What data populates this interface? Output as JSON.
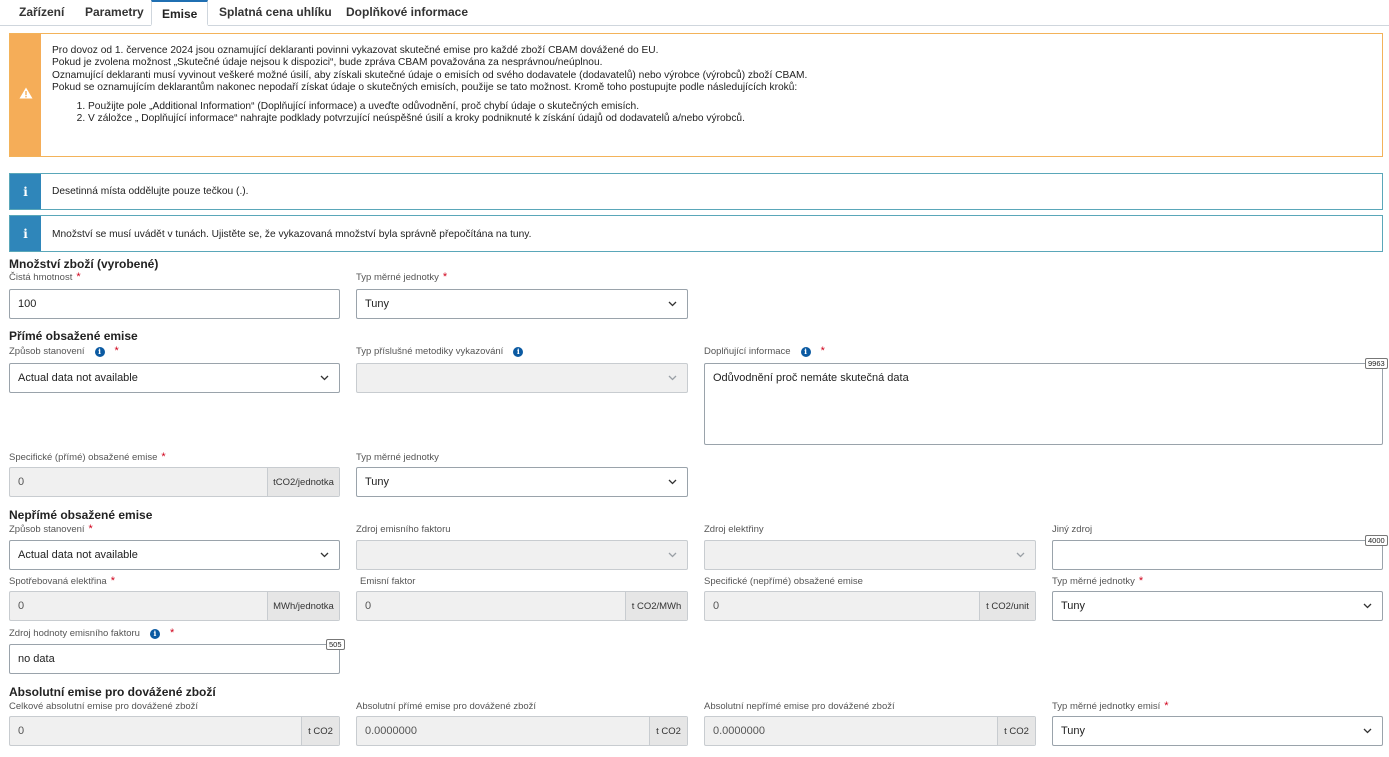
{
  "tabs": [
    {
      "label": "Zařízení"
    },
    {
      "label": "Parametry"
    },
    {
      "label": "Emise"
    },
    {
      "label": "Splatná cena uhlíku"
    },
    {
      "label": "Doplňkové informace"
    }
  ],
  "colors": {
    "warning": "#f5ad58",
    "info": "#2f86ba",
    "required": "#d0021b",
    "active_tab": "#1f6fb2"
  },
  "alerts": {
    "warning": {
      "icon": "warning-triangle-icon",
      "lines": [
        "Pro dovoz od 1. července 2024 jsou oznamující deklaranti povinni vykazovat skutečné emise pro každé zboží CBAM dovážené do EU.",
        "Pokud je zvolena možnost „Skutečné údaje nejsou k dispozici“, bude zpráva CBAM považována za nesprávnou/neúplnou.",
        "Oznamující deklaranti musí vyvinout veškeré možné úsilí, aby získali skutečné údaje o emisích od svého dodavatele (dodavatelů) nebo výrobce (výrobců) zboží CBAM.",
        "Pokud se oznamujícím deklarantům nakonec nepodaří získat údaje o skutečných emisích, použije se tato možnost. Kromě toho postupujte podle následujících kroků:"
      ],
      "steps": [
        "Použijte pole „Additional Information“ (Doplňující informace) a uveďte odůvodnění, proč chybí údaje o skutečných emisích.",
        "V záložce „ Doplňující informace“ nahrajte podklady potvrzující neúspěšné úsilí a kroky podniknuté k získání údajů od dodavatelů a/nebo výrobců."
      ]
    },
    "info1": {
      "icon": "info-icon",
      "text": "Desetinná místa oddělujte pouze tečkou (.)."
    },
    "info2": {
      "icon": "info-icon",
      "text": "Množství se musí uvádět v tunách. Ujistěte se, že vykazovaná množství byla správně přepočítána na tuny."
    }
  },
  "quantity": {
    "title": "Množství zboží (vyrobené)",
    "net_mass": {
      "label": "Čistá hmotnost",
      "value": "100"
    },
    "unit_type": {
      "label": "Typ měrné jednotky",
      "value": "Tuny"
    }
  },
  "direct": {
    "title": "Přímé obsažené emise",
    "method": {
      "label": "Způsob stanovení",
      "value": "Actual data not available"
    },
    "reporting_method": {
      "label": "Typ příslušné metodiky vykazování",
      "value": ""
    },
    "additional_info": {
      "label": "Doplňující informace",
      "value": "Odůvodnění proč nemáte skutečná data",
      "counter": "9963"
    },
    "specific": {
      "label": "Specifické (přímé) obsažené emise",
      "value": "0",
      "unit": "tCO2/jednotka"
    },
    "unit_type": {
      "label": "Typ měrné jednotky",
      "value": "Tuny"
    }
  },
  "indirect": {
    "title": "Nepřímé obsažené emise",
    "method": {
      "label": "Způsob stanovení",
      "value": "Actual data not available"
    },
    "factor_source": {
      "label": "Zdroj emisního faktoru",
      "value": ""
    },
    "electricity_source": {
      "label": "Zdroj elektřiny",
      "value": ""
    },
    "other_source": {
      "label": "Jiný zdroj",
      "value": "",
      "counter": "4000"
    },
    "consumed": {
      "label": "Spotřebovaná elektřina",
      "value": "0",
      "unit": "MWh/jednotka"
    },
    "factor": {
      "label": "Emisní faktor",
      "value": "0",
      "unit": "t CO2/MWh"
    },
    "specific": {
      "label": "Specifické (nepřímé) obsažené emise",
      "value": "0",
      "unit": "t CO2/unit"
    },
    "unit_type": {
      "label": "Typ měrné jednotky",
      "value": "Tuny"
    },
    "factor_value_source": {
      "label": "Zdroj hodnoty emisního faktoru",
      "value": "no data",
      "counter": "505"
    }
  },
  "absolute": {
    "title": "Absolutní emise pro dovážené zboží",
    "total": {
      "label": "Celkové absolutní emise pro dovážené zboží",
      "value": "0",
      "unit": "t CO2"
    },
    "direct": {
      "label": "Absolutní přímé emise pro dovážené zboží",
      "value": "0.0000000",
      "unit": "t CO2"
    },
    "indirect": {
      "label": "Absolutní nepřímé emise pro dovážené zboží",
      "value": "0.0000000",
      "unit": "t CO2"
    },
    "unit_type": {
      "label": "Typ měrné jednotky emisí",
      "value": "Tuny"
    }
  }
}
